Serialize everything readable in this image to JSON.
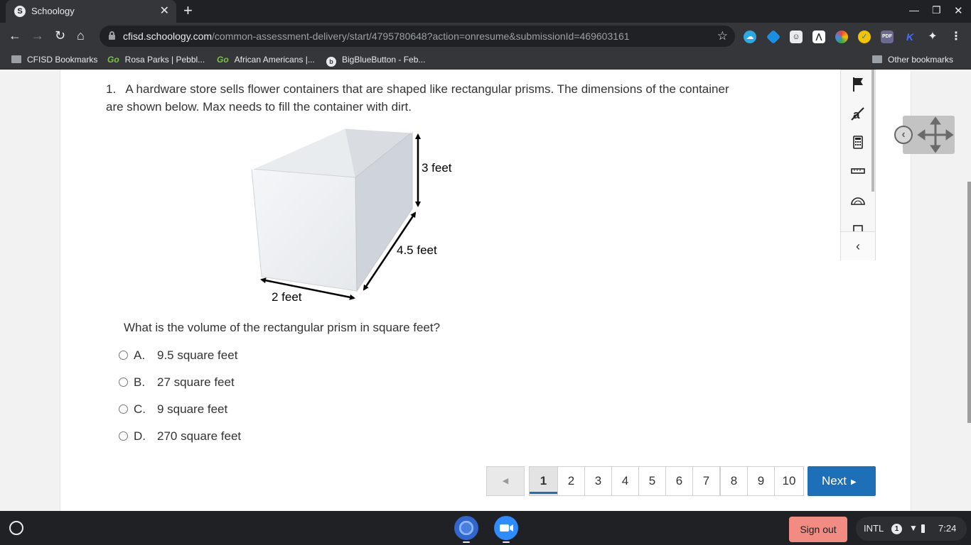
{
  "browser": {
    "tab_title": "Schoology",
    "tab_favicon_letter": "S",
    "url_host": "cfisd.schoology.com",
    "url_path": "/common-assessment-delivery/start/4795780648?action=onresume&submissionId=469603161",
    "bookmarks": [
      {
        "label": "CFISD Bookmarks",
        "icon": "folder-icon"
      },
      {
        "label": "Rosa Parks | Pebbl...",
        "icon": "go-icon",
        "icon_text": "Go"
      },
      {
        "label": "African Americans |...",
        "icon": "go-icon",
        "icon_text": "Go"
      },
      {
        "label": "BigBlueButton - Feb...",
        "icon": "bigbluebutton-icon",
        "icon_text": "b"
      }
    ],
    "other_bookmarks": "Other bookmarks"
  },
  "question": {
    "number": "1.",
    "text_line1": "A hardware store sells flower containers that are shaped like rectangular prisms.  The dimensions of the container",
    "text_line2": "are shown below. Max needs to fill the container with dirt.",
    "figure": {
      "height_label": "3 feet",
      "length_label": "4.5 feet",
      "width_label": "2 feet"
    },
    "prompt": "What is the volume of the rectangular prism in square feet?",
    "choices": [
      {
        "letter": "A.",
        "text": "9.5 square feet"
      },
      {
        "letter": "B.",
        "text": "27 square feet"
      },
      {
        "letter": "C.",
        "text": "9 square feet"
      },
      {
        "letter": "D.",
        "text": "270 square feet"
      }
    ]
  },
  "pagination": {
    "pages": [
      "1",
      "2",
      "3",
      "4",
      "5",
      "6",
      "7",
      "8",
      "9",
      "10"
    ],
    "current": "1",
    "next_label": "Next"
  },
  "tools": [
    "flag-icon",
    "eliminate-answer-icon",
    "calculator-icon",
    "ruler-icon",
    "protractor-icon",
    "line-reader-icon"
  ],
  "shelf": {
    "signout_label": "Sign out",
    "keyboard": "INTL",
    "notification_count": "1",
    "time": "7:24"
  },
  "colors": {
    "accent": "#1d6fb8",
    "signout": "#f28b82",
    "chrome_dark": "#202124"
  }
}
